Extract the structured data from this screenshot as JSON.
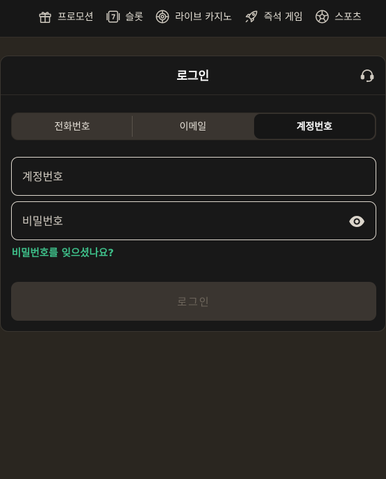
{
  "nav": {
    "items": [
      {
        "label": "프로모션",
        "icon": "gift-icon"
      },
      {
        "label": "슬롯",
        "icon": "slot-machine-icon"
      },
      {
        "label": "라이브 카지노",
        "icon": "casino-chip-icon"
      },
      {
        "label": "즉석 게임",
        "icon": "rocket-icon"
      },
      {
        "label": "스포츠",
        "icon": "soccer-ball-icon"
      }
    ]
  },
  "login": {
    "title": "로그인",
    "tabs": [
      {
        "label": "전화번호",
        "active": false
      },
      {
        "label": "이메일",
        "active": false
      },
      {
        "label": "계정번호",
        "active": true
      }
    ],
    "account_placeholder": "계정번호",
    "password_placeholder": "비밀번호",
    "forgot_label": "비밀번호를 잊으셨나요?",
    "submit_label": "로그인"
  },
  "colors": {
    "page_bg": "#2a2620",
    "card_bg": "#181818",
    "accent_green": "#3ec08a",
    "tab_bg": "#3a3530"
  }
}
